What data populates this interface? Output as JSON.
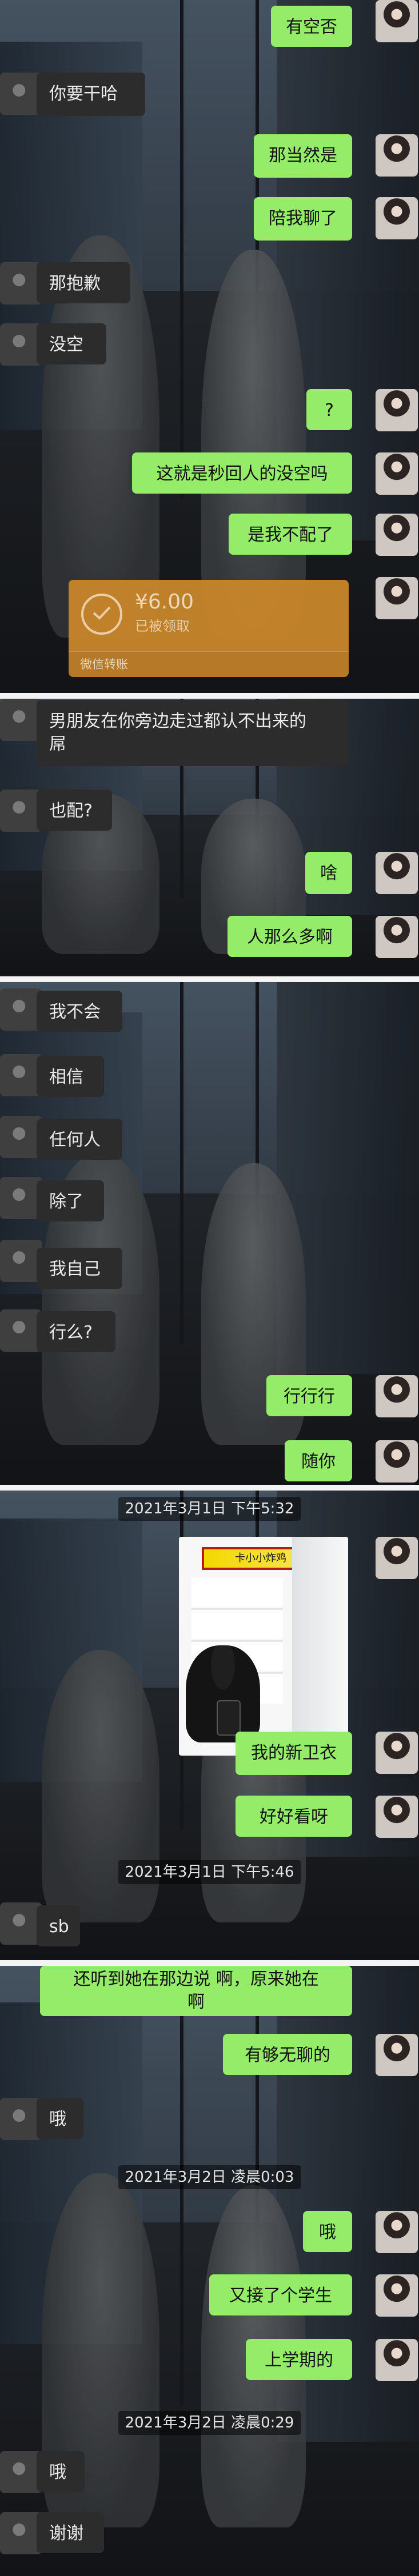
{
  "messages": [
    {
      "side": "me",
      "text": "有空否"
    },
    {
      "side": "other",
      "text": "你要干哈"
    },
    {
      "side": "me",
      "text": "那当然是"
    },
    {
      "side": "me",
      "text": "陪我聊了"
    },
    {
      "side": "other",
      "text": "那抱歉"
    },
    {
      "side": "other",
      "text": "没空"
    },
    {
      "side": "me",
      "text": "?"
    },
    {
      "side": "me",
      "text": "这就是秒回人的没空吗"
    },
    {
      "side": "me",
      "text": "是我不配了"
    },
    {
      "side": "other",
      "text": "男朋友在你旁边走过都认不出来的\n屌"
    },
    {
      "side": "other",
      "text": "也配?"
    },
    {
      "side": "me",
      "text": "啥"
    },
    {
      "side": "me",
      "text": "人那么多啊"
    },
    {
      "side": "other",
      "text": "我不会"
    },
    {
      "side": "other",
      "text": "相信"
    },
    {
      "side": "other",
      "text": "任何人"
    },
    {
      "side": "other",
      "text": "除了"
    },
    {
      "side": "other",
      "text": "我自己"
    },
    {
      "side": "other",
      "text": "行么?"
    },
    {
      "side": "me",
      "text": "行行行"
    },
    {
      "side": "me",
      "text": "随你"
    },
    {
      "side": "me",
      "text": "我的新卫衣"
    },
    {
      "side": "me",
      "text": "好好看呀"
    },
    {
      "side": "other",
      "text": "sb"
    },
    {
      "side": "me",
      "text": "还听到她在那边说 啊，原来她在\n啊"
    },
    {
      "side": "me",
      "text": "有够无聊的"
    },
    {
      "side": "other",
      "text": "哦"
    },
    {
      "side": "me",
      "text": "哦"
    },
    {
      "side": "me",
      "text": "又接了个学生"
    },
    {
      "side": "me",
      "text": "上学期的"
    },
    {
      "side": "other",
      "text": "哦"
    },
    {
      "side": "other",
      "text": "谢谢"
    }
  ],
  "timestamps": [
    "2021年3月1日 下午5:32",
    "2021年3月1日 下午5:46",
    "2021年3月2日 凌晨0:03",
    "2021年3月2日 凌晨0:29"
  ],
  "transfer": {
    "amount": "¥6.00",
    "status": "已被领取",
    "label": "微信转账"
  },
  "photo": {
    "banner_text": "卡小小炸鸡",
    "description_icon": "new-hoodie-photo-icon"
  },
  "colors": {
    "my_bubble": "#95ec69",
    "other_bubble": "#2c2c2c",
    "transfer": "#c9862b"
  }
}
